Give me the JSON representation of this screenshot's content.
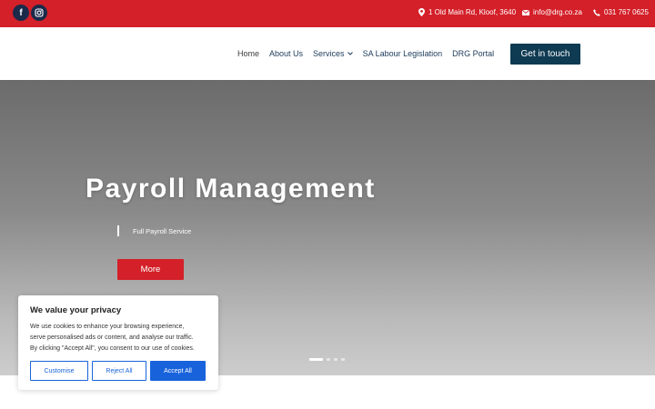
{
  "topbar": {
    "color": "#d42029",
    "social": [
      {
        "icon": "facebook-icon",
        "glyph": "f"
      },
      {
        "icon": "instagram-icon"
      }
    ],
    "address": "1 Old Main Rd, Kloof, 3640",
    "email": "info@drg.co.za",
    "phone": "031 767 0625"
  },
  "nav": {
    "items": [
      "Home",
      "About Us",
      "Services",
      "SA Labour Legislation",
      "DRG Portal"
    ],
    "cta": "Get in touch"
  },
  "hero": {
    "title": "Payroll Management",
    "subtitle": "Full Payroll Service",
    "button": "More",
    "slides_total": 4,
    "active_slide": 1
  },
  "cookie": {
    "title": "We value your privacy",
    "lines": [
      "We use cookies to enhance your browsing experience,",
      "serve personalised ads or content, and analyse our traffic.",
      "By clicking \"Accept All\", you consent to our use of cookies."
    ],
    "customise": "Customise",
    "reject": "Reject All",
    "accept": "Accept All",
    "accent": "#1863dc"
  }
}
